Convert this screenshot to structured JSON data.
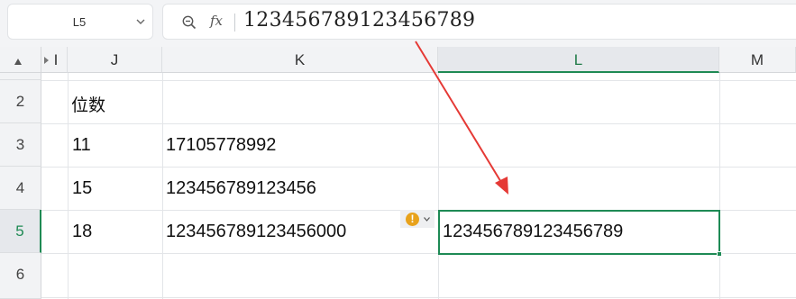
{
  "name_box": {
    "value": "L5"
  },
  "formula_bar": {
    "fx_label": "fx",
    "value": "123456789123456789"
  },
  "columns": [
    {
      "id": "prev",
      "label": "I"
    },
    {
      "id": "J",
      "label": "J"
    },
    {
      "id": "K",
      "label": "K"
    },
    {
      "id": "L",
      "label": "L",
      "active": true
    },
    {
      "id": "M",
      "label": "M"
    }
  ],
  "rows": [
    {
      "label": "2",
      "J": "位数",
      "K": "",
      "L": ""
    },
    {
      "label": "3",
      "J": "11",
      "K": "17105778992",
      "L": ""
    },
    {
      "label": "4",
      "J": "15",
      "K": "123456789123456",
      "L": ""
    },
    {
      "label": "5",
      "J": "18",
      "K": "123456789123456000",
      "L": "123456789123456789",
      "active": true
    },
    {
      "label": "6",
      "J": "",
      "K": "",
      "L": ""
    }
  ],
  "selected_cell": "L5",
  "warning_badge": {
    "symbol": "!"
  },
  "colors": {
    "selection": "#1e8a55",
    "warning": "#e8a21b",
    "arrow": "#e53935"
  }
}
